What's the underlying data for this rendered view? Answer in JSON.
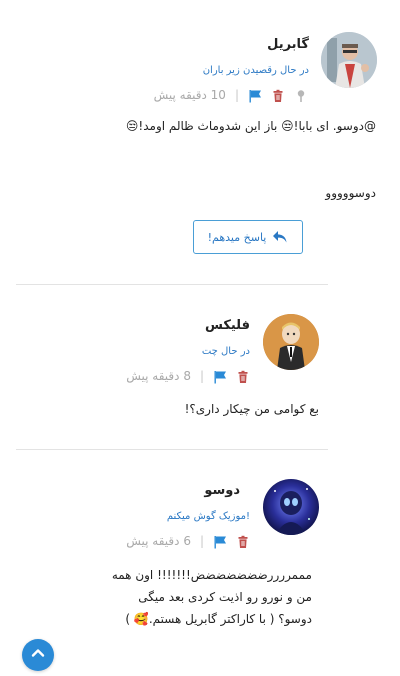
{
  "comments": [
    {
      "name": "گابریل",
      "status": "در حال رقصیدن زیر باران",
      "time": "10 دقیقه پیش",
      "body_line1": "@دوسو. ای بابا!😒 باز این شدوماث ظالم اومد!😒",
      "body_line2": "دوسووووو",
      "reply_label": "پاسخ میدهم!",
      "has_pin": true
    },
    {
      "name": "فلیکس",
      "status": "در حال چت",
      "time": "8 دقیقه پیش",
      "body_line1": "بع کوامی من چیکار داری؟!"
    },
    {
      "name": "دوسو",
      "status": "موزیک گوش میکنم!",
      "time": "6 دقیقه پیش",
      "body_line1": "مممررررضضضضضضض!!!!!!! اون همه",
      "body_line2": "من و نورو رو اذیت کردی بعد میگی",
      "body_line3": "دوسو؟ ( با کاراکتر گابریل هستم.🥰 )"
    }
  ],
  "colors": {
    "accent": "#2a78c4",
    "trash": "#c0504d",
    "muted": "#a9a9a9"
  },
  "icons": [
    "pin-icon",
    "trash-icon",
    "flag-icon",
    "reply-icon",
    "chevron-up-icon"
  ]
}
